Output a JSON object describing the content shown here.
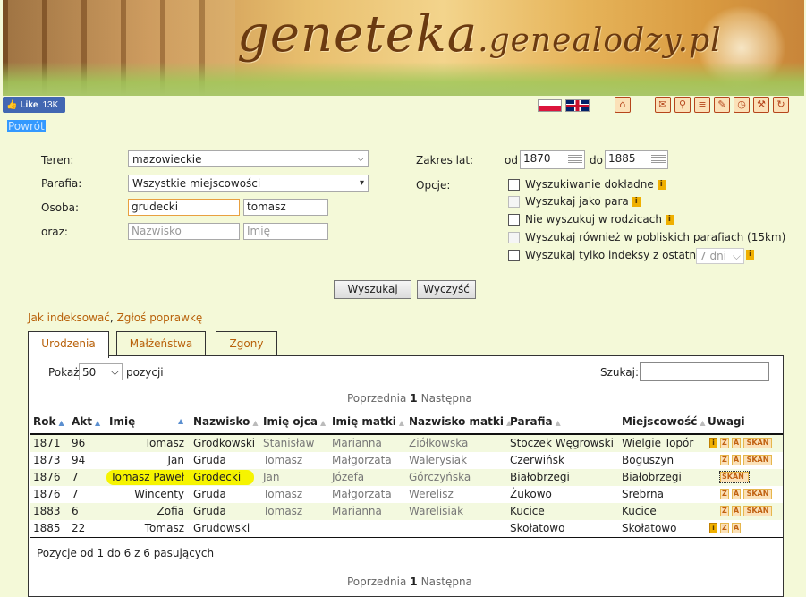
{
  "header": {
    "logo_main": "geneteka",
    "logo_domain": ".genealodzy.pl",
    "fb_like": "Like",
    "fb_count": "13K",
    "flags": [
      "polish-flag",
      "english-flag"
    ],
    "toolbar_icons": [
      "home-icon",
      "email-icon",
      "search-icon",
      "list-icon",
      "edit-icon",
      "clock-icon",
      "tools-icon",
      "refresh-icon"
    ]
  },
  "back_link": "Powrót",
  "form": {
    "teren_label": "Teren:",
    "teren_value": "mazowieckie",
    "parafia_label": "Parafia:",
    "parafia_value": "Wszystkie miejscowości",
    "osoba_label": "Osoba:",
    "osoba_surname": "grudecki",
    "osoba_name": "tomasz",
    "oraz_label": "oraz:",
    "oraz_surname_ph": "Nazwisko",
    "oraz_name_ph": "Imię",
    "zakres_label": "Zakres lat:",
    "od_label": "od",
    "od_value": "1870",
    "do_label": "do",
    "do_value": "1885",
    "opcje_label": "Opcje:",
    "options": [
      "Wyszukiwanie dokładne",
      "Wyszukaj jako para",
      "Nie wyszukuj w rodzicach",
      "Wyszukaj również w pobliskich parafiach (15km)",
      "Wyszukaj tylko indeksy z ostatnich"
    ],
    "days_value": "7 dni",
    "search_button": "Wyszukaj",
    "clear_button": "Wyczyść"
  },
  "help_links": {
    "how_to_index": "Jak indeksować",
    "separator": ",",
    "report_fix": "Zgłoś poprawkę"
  },
  "tabs": [
    "Urodzenia",
    "Małżeństwa",
    "Zgony"
  ],
  "table_controls": {
    "show_label": "Pokaż",
    "show_value": "50",
    "show_suffix": "pozycji",
    "search_label": "Szukaj:",
    "prev": "Poprzednia",
    "page": "1",
    "next": "Następna",
    "info": "Pozycje od 1 do 6 z 6 pasujących"
  },
  "columns": [
    "Rok",
    "Akt",
    "Imię",
    "Nazwisko",
    "Imię ojca",
    "Imię matki",
    "Nazwisko matki",
    "Parafia",
    "Miejscowość",
    "Uwagi"
  ],
  "rows": [
    {
      "rok": "1871",
      "akt": "96",
      "imie": "Tomasz",
      "nazwisko": "Grodkowski",
      "ojciec": "Stanisław",
      "matka": "Marianna",
      "nazw_matki": "Ziółkowska",
      "parafia": "Stoczek Węgrowski",
      "miejsc": "Wielgie Topór",
      "uwagi": [
        "i",
        "Z",
        "A",
        "SKAN"
      ]
    },
    {
      "rok": "1873",
      "akt": "94",
      "imie": "Jan",
      "nazwisko": "Gruda",
      "ojciec": "Tomasz",
      "matka": "Małgorzata",
      "nazw_matki": "Walerysiak",
      "parafia": "Czerwińsk",
      "miejsc": "Boguszyn",
      "uwagi": [
        "Z",
        "A",
        "SKAN"
      ]
    },
    {
      "rok": "1876",
      "akt": "7",
      "imie": "Tomasz Paweł",
      "nazwisko": "Grodecki",
      "ojciec": "Jan",
      "matka": "Józefa",
      "nazw_matki": "Górczyńska",
      "parafia": "Białobrzegi",
      "miejsc": "Białobrzegi",
      "uwagi": [
        "Z",
        "A",
        "SKAN"
      ]
    },
    {
      "rok": "1876",
      "akt": "7",
      "imie": "Wincenty",
      "nazwisko": "Gruda",
      "ojciec": "Tomasz",
      "matka": "Małgorzata",
      "nazw_matki": "Werelisz",
      "parafia": "Żukowo",
      "miejsc": "Srebrna",
      "uwagi": [
        "Z",
        "A",
        "SKAN"
      ]
    },
    {
      "rok": "1883",
      "akt": "6",
      "imie": "Zofia",
      "nazwisko": "Gruda",
      "ojciec": "Tomasz",
      "matka": "Marianna",
      "nazw_matki": "Warelisiak",
      "parafia": "Kucice",
      "miejsc": "Kucice",
      "uwagi": [
        "Z",
        "A",
        "SKAN"
      ]
    },
    {
      "rok": "1885",
      "akt": "22",
      "imie": "Tomasz",
      "nazwisko": "Grudowski",
      "ojciec": "",
      "matka": "",
      "nazw_matki": "",
      "parafia": "Skołatowo",
      "miejsc": "Skołatowo",
      "uwagi": [
        "i",
        "Z",
        "A"
      ]
    }
  ],
  "colors": {
    "page_bg": "#f4f9d8",
    "link": "#b8610a",
    "highlight": "#f6f400",
    "row_alt": "#f3f9df"
  }
}
